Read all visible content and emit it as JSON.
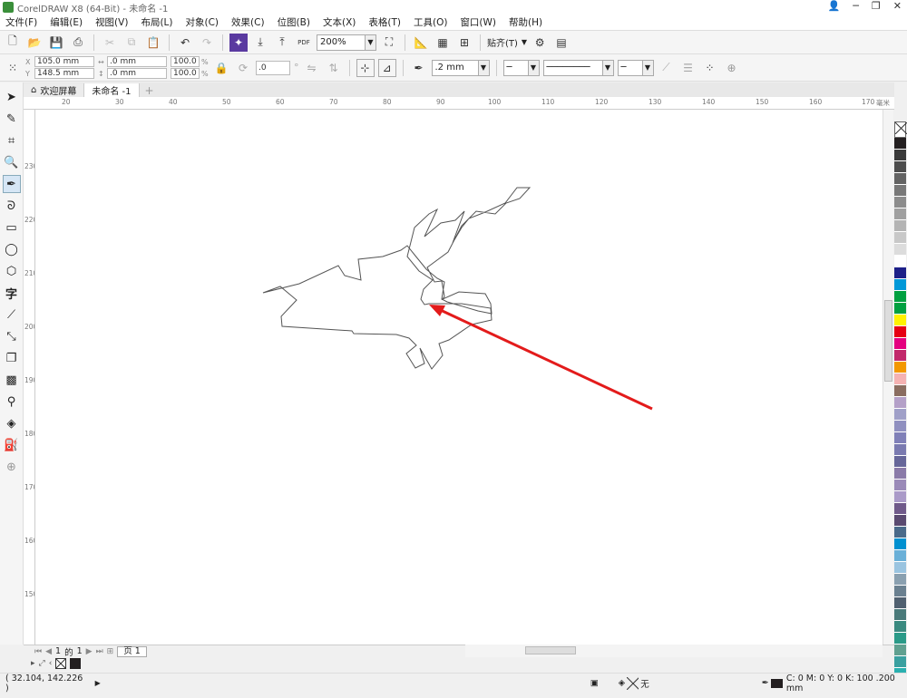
{
  "window": {
    "title": "CorelDRAW X8 (64-Bit) - 未命名 -1"
  },
  "menu": [
    "文件(F)",
    "编辑(E)",
    "视图(V)",
    "布局(L)",
    "对象(C)",
    "效果(C)",
    "位图(B)",
    "文本(X)",
    "表格(T)",
    "工具(O)",
    "窗口(W)",
    "帮助(H)"
  ],
  "toolbar": {
    "zoom": "200%",
    "snap_label": "贴齐(T)",
    "pdf_label": "PDF"
  },
  "props": {
    "x": "105.0 mm",
    "y": "148.5 mm",
    "w": ".0 mm",
    "h": ".0 mm",
    "scale_w": "100.0",
    "scale_h": "100.0",
    "pct": "%",
    "rotation": ".0",
    "outline_width": ".2 mm"
  },
  "tabs": {
    "welcome": "欢迎屏幕",
    "doc": "未命名 -1"
  },
  "ruler": {
    "h_labels": [
      "20",
      "30",
      "40",
      "50",
      "60",
      "70",
      "80",
      "90",
      "100",
      "110",
      "120",
      "130",
      "140",
      "150",
      "160",
      "170"
    ],
    "v_labels": [
      "230",
      "220",
      "210",
      "200",
      "190",
      "180",
      "170",
      "160",
      "150"
    ],
    "unit": "毫米"
  },
  "pagebar": {
    "current": "1",
    "of": "的",
    "total": "1",
    "page_tab": "页 1"
  },
  "status": {
    "coords": "( 32.104, 142.226 )",
    "fill_none": "无",
    "outline_info": "C: 0 M: 0 Y: 0 K: 100  .200 mm"
  },
  "colors": {
    "palette": [
      "#231f20",
      "#3a3a3a",
      "#4d4d4d",
      "#636363",
      "#787878",
      "#8c8c8c",
      "#a0a0a0",
      "#b4b4b4",
      "#c8c8c8",
      "#dcdcdc",
      "#ffffff",
      "#1d2088",
      "#0098d8",
      "#00a040",
      "#00a040",
      "#fff100",
      "#e60012",
      "#e4007f",
      "#c2296b",
      "#f39800",
      "#f5b2b2",
      "#8a6d60",
      "#b4a0c8",
      "#a0a0c8",
      "#9090c0",
      "#8080b8",
      "#7a7ab0",
      "#666699",
      "#8a7aa8",
      "#9a8ab8",
      "#aa9ac8",
      "#705a8a",
      "#5a4a70",
      "#4a6a8a",
      "#0090d0",
      "#6ab0d8",
      "#9ac4e0",
      "#8aa0b0",
      "#6a8090",
      "#506070",
      "#4a7a7a",
      "#3a8a80",
      "#2a9a88",
      "#60a090",
      "#3aa0a0",
      "#2ab0b0",
      "#2a8a8a"
    ],
    "shape_stroke": "#555555",
    "arrow": "#e31b1b"
  }
}
